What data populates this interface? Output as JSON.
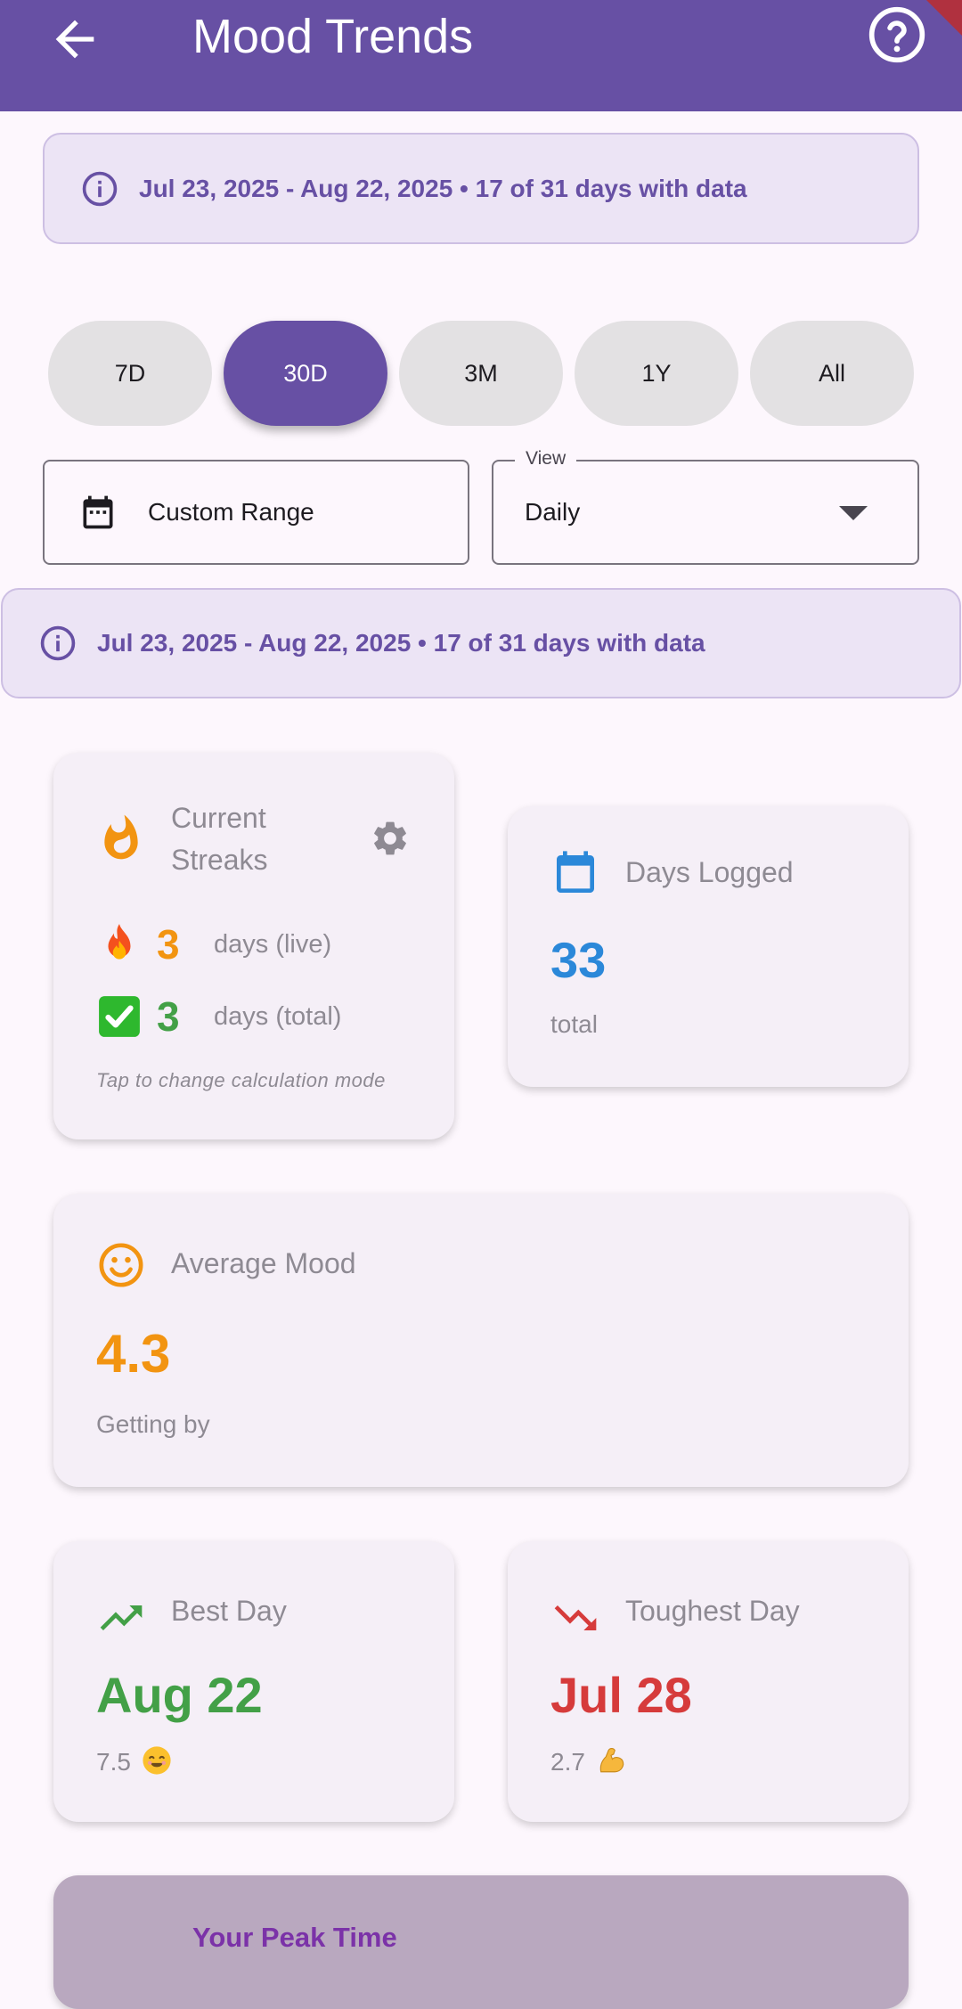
{
  "app_bar": {
    "title": "Mood Trends",
    "back_icon": "arrow-back-icon",
    "help_icon": "help-circle-icon",
    "background_color": "#6750a4"
  },
  "date_banner_top": {
    "text": "Jul 23, 2025 - Aug 22, 2025 • 17 of 31 days with data",
    "icon": "info-icon"
  },
  "range_chips": [
    {
      "label": "7D",
      "selected": false
    },
    {
      "label": "30D",
      "selected": true
    },
    {
      "label": "3M",
      "selected": false
    },
    {
      "label": "1Y",
      "selected": false
    },
    {
      "label": "All",
      "selected": false
    }
  ],
  "custom_range": {
    "label": "Custom Range",
    "icon": "calendar-icon"
  },
  "view_select": {
    "legend": "View",
    "value": "Daily"
  },
  "date_banner_second": {
    "text": "Jul 23, 2025 - Aug 22, 2025 • 17 of 31 days with data",
    "icon": "info-icon"
  },
  "streaks": {
    "title": "Current Streaks",
    "icon": "flame-icon",
    "settings_icon": "gear-icon",
    "live": {
      "value": "3",
      "label": "days (live)",
      "emoji": "🔥",
      "color": "#f29411"
    },
    "total": {
      "value": "3",
      "label": "days (total)",
      "emoji": "✅",
      "color": "#43a047"
    },
    "hint": "Tap to change calculation mode"
  },
  "days_logged": {
    "title": "Days Logged",
    "icon": "calendar-icon",
    "value": "33",
    "subtext": "total",
    "color": "#2b88d9"
  },
  "average_mood": {
    "title": "Average Mood",
    "icon": "smiley-icon",
    "value": "4.3",
    "subtext": "Getting by",
    "color": "#f29411"
  },
  "best_day": {
    "title": "Best Day",
    "icon": "trending-up-icon",
    "value": "Aug 22",
    "score": "7.5",
    "emoji": "😊",
    "color": "#43a047"
  },
  "toughest_day": {
    "title": "Toughest Day",
    "icon": "trending-down-icon",
    "value": "Jul 28",
    "score": "2.7",
    "emoji": "💪",
    "color": "#d63b3b"
  },
  "peak_time": {
    "title": "Your Peak Time"
  }
}
